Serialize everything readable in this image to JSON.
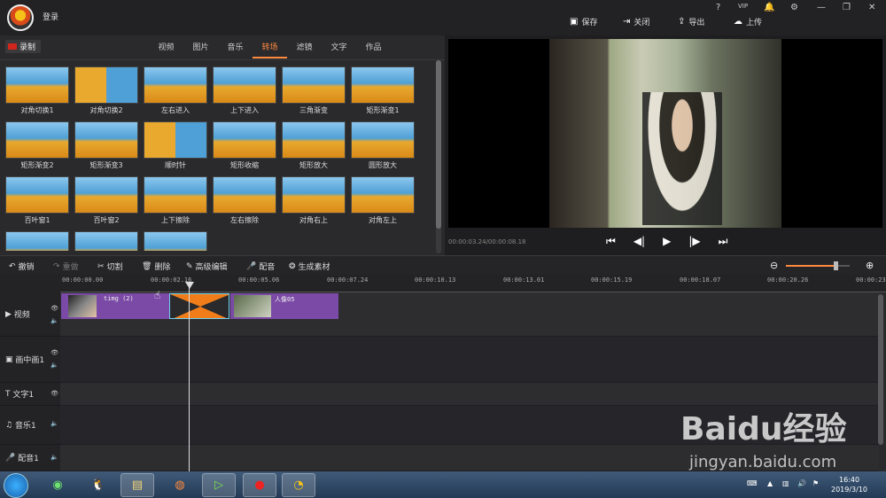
{
  "header": {
    "login": "登录",
    "actions": [
      {
        "icon": "save-icon",
        "label": "保存"
      },
      {
        "icon": "close-icon",
        "label": "关闭"
      },
      {
        "icon": "export-icon",
        "label": "导出"
      },
      {
        "icon": "upload-icon",
        "label": "上传"
      }
    ],
    "window_controls": [
      "?",
      "VIP",
      "🔔",
      "⚙",
      "—",
      "❐",
      "✕"
    ]
  },
  "left_panel": {
    "record": "录制",
    "tabs": [
      "视频",
      "图片",
      "音乐",
      "转场",
      "滤镜",
      "文字",
      "作品"
    ],
    "active_tab": "转场",
    "transitions": [
      "对角切换1",
      "对角切换2",
      "左右进入",
      "上下进入",
      "三角渐变",
      "矩形渐变1",
      "矩形渐变2",
      "矩形渐变3",
      "顺时针",
      "矩形收缩",
      "矩形放大",
      "圆形放大",
      "百叶窗1",
      "百叶窗2",
      "上下擦除",
      "左右擦除",
      "对角右上",
      "对角左上",
      "",
      "",
      ""
    ]
  },
  "preview": {
    "timecode": "00:00:03.24/00:00:08.18",
    "controls": [
      "⏮",
      "◀|",
      "▶",
      "|▶",
      "⏭"
    ]
  },
  "toolbar": {
    "undo": "撤销",
    "redo": "重做",
    "cut": "切割",
    "delete": "删除",
    "advanced": "高级编辑",
    "dub": "配音",
    "generate": "生成素材",
    "zoom_level": 0.78
  },
  "ruler": [
    "00:00:00.00",
    "00:00:02.16",
    "00:00:05.06",
    "00:00:07.24",
    "00:00:10.13",
    "00:00:13.01",
    "00:00:15.19",
    "00:00:18.07",
    "00:00:20.26",
    "00:00:23."
  ],
  "tracks": [
    "视频",
    "画中画1",
    "文字1",
    "音乐1",
    "配音1"
  ],
  "clips": {
    "clip1": "timg (2)",
    "clip2": "人像05"
  },
  "taskbar": {
    "time": "16:40",
    "date": "2019/3/10"
  },
  "watermark": {
    "brand": "Baidu经验",
    "url": "jingyan.baidu.com"
  }
}
